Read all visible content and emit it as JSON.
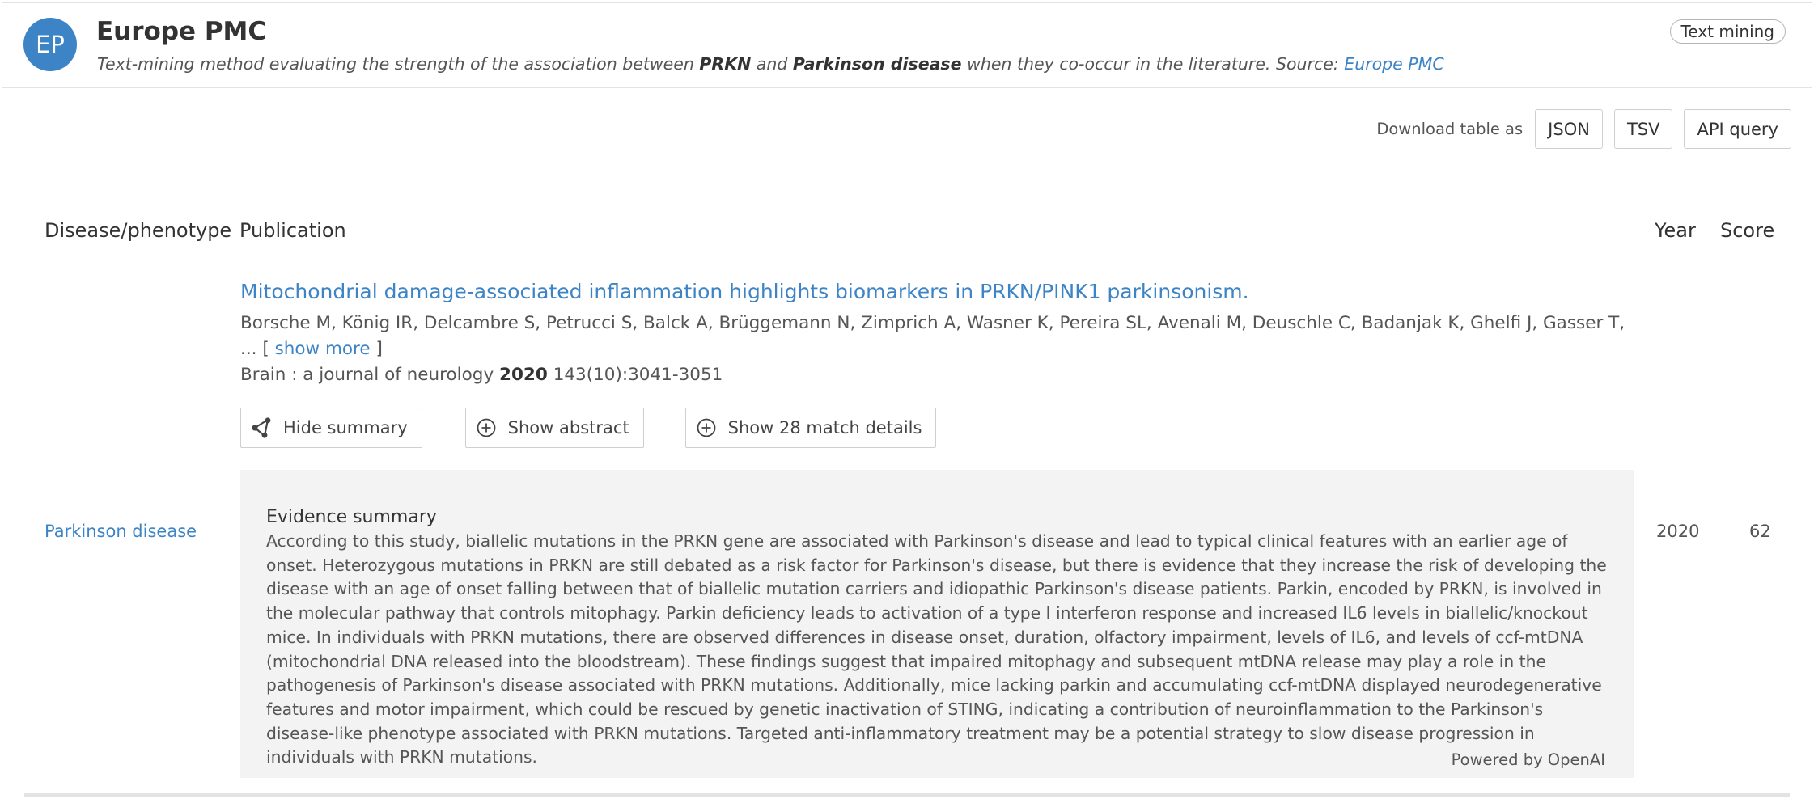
{
  "source": {
    "avatar": "EP",
    "title": "Europe PMC",
    "desc_pre": "Text-mining method evaluating the strength of the association between ",
    "target": "PRKN",
    "desc_and": " and ",
    "disease": "Parkinson disease",
    "desc_post": " when they co-occur in the literature. Source: ",
    "source_link": "Europe PMC",
    "tag": "Text mining"
  },
  "download": {
    "label": "Download table as",
    "json": "JSON",
    "tsv": "TSV",
    "api": "API query"
  },
  "table": {
    "headers": {
      "disease": "Disease/phenotype",
      "publication": "Publication",
      "year": "Year",
      "score": "Score"
    },
    "row": {
      "disease": "Parkinson disease",
      "title": "Mitochondrial damage-associated inflammation highlights biomarkers in PRKN/PINK1 parkinsonism.",
      "authors": "Borsche M, König IR, Delcambre S, Petrucci S, Balck A, Brüggemann N, Zimprich A, Wasner K, Pereira SL, Avenali M, Deuschle C, Badanjak K, Ghelfi J, Gasser T,",
      "authors_more_prefix": "... [ ",
      "show_more": "show more",
      "authors_more_suffix": " ]",
      "journal": "Brain : a journal of neurology ",
      "pub_year": "2020",
      "volume": " 143(10):3041-3051",
      "hide_summary": "Hide summary",
      "show_abstract": "Show abstract",
      "show_match": "Show 28 match details",
      "summary_title": "Evidence summary",
      "summary_text": "According to this study, biallelic mutations in the PRKN gene are associated with Parkinson's disease and lead to typical clinical features with an earlier age of onset. Heterozygous mutations in PRKN are still debated as a risk factor for Parkinson's disease, but there is evidence that they increase the risk of developing the disease with an age of onset falling between that of biallelic mutation carriers and idiopathic Parkinson's disease patients. Parkin, encoded by PRKN, is involved in the molecular pathway that controls mitophagy. Parkin deficiency leads to activation of a type I interferon response and increased IL6 levels in biallelic/knockout mice. In individuals with PRKN mutations, there are observed differences in disease onset, duration, olfactory impairment, levels of IL6, and levels of ccf-mtDNA (mitochondrial DNA released into the bloodstream). These findings suggest that impaired mitophagy and subsequent mtDNA release may play a role in the pathogenesis of Parkinson's disease associated with PRKN mutations. Additionally, mice lacking parkin and accumulating ccf-mtDNA displayed neurodegenerative features and motor impairment, which could be rescued by genetic inactivation of STING, indicating a contribution of neuroinflammation to the Parkinson's disease-like phenotype associated with PRKN mutations. Targeted anti-inflammatory treatment may be a potential strategy to slow disease progression in individuals with PRKN mutations.",
      "powered_by": "Powered by OpenAI",
      "year": "2020",
      "score": "62"
    }
  },
  "icons": {
    "summary": "share-nodes-icon",
    "abstract": "plus-circle-icon",
    "match": "plus-circle-icon"
  },
  "colors": {
    "accent": "#3d84c6",
    "summary_bg": "#f3f3f3",
    "border": "#e3e3e3"
  }
}
